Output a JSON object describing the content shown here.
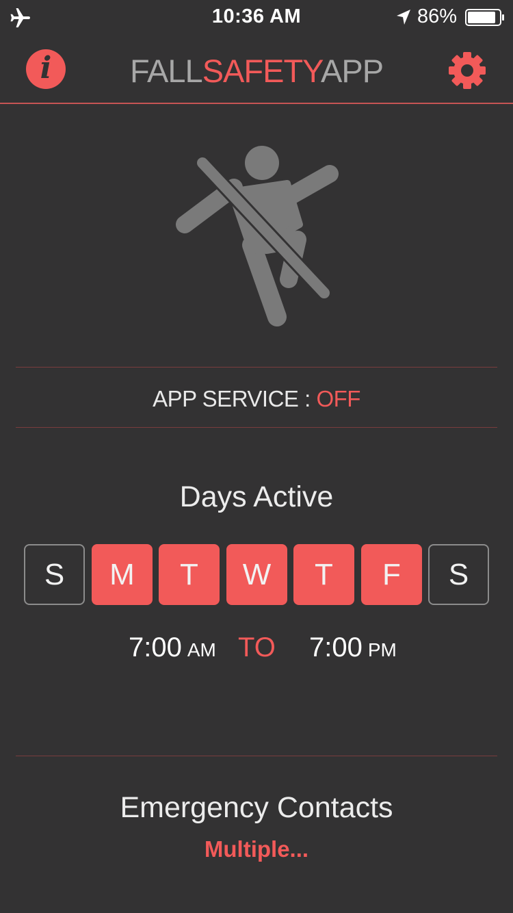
{
  "status_bar": {
    "time": "10:36 AM",
    "battery_percent": "86%",
    "icons": [
      "airplane-icon",
      "location-arrow-icon",
      "battery-icon"
    ]
  },
  "nav": {
    "title_part1": "FALL",
    "title_part2": "SAFETY",
    "title_part3": "APP",
    "info_label": "i",
    "icons": [
      "info-icon",
      "gear-icon"
    ]
  },
  "hero": {
    "icon": "no-fall-icon"
  },
  "service": {
    "label": "APP SERVICE : ",
    "status": "OFF"
  },
  "days_active": {
    "title": "Days Active",
    "days": [
      {
        "label": "S",
        "active": false
      },
      {
        "label": "M",
        "active": true
      },
      {
        "label": "T",
        "active": true
      },
      {
        "label": "W",
        "active": true
      },
      {
        "label": "T",
        "active": true
      },
      {
        "label": "F",
        "active": true
      },
      {
        "label": "S",
        "active": false
      }
    ]
  },
  "schedule": {
    "from_time": "7:00",
    "from_ampm": "AM",
    "to_label": "TO",
    "to_time": "7:00",
    "to_ampm": "PM"
  },
  "emergency": {
    "title": "Emergency Contacts",
    "value": "Multiple..."
  },
  "colors": {
    "background": "#333233",
    "accent": "#f25a59",
    "muted": "#a7a7a7"
  }
}
